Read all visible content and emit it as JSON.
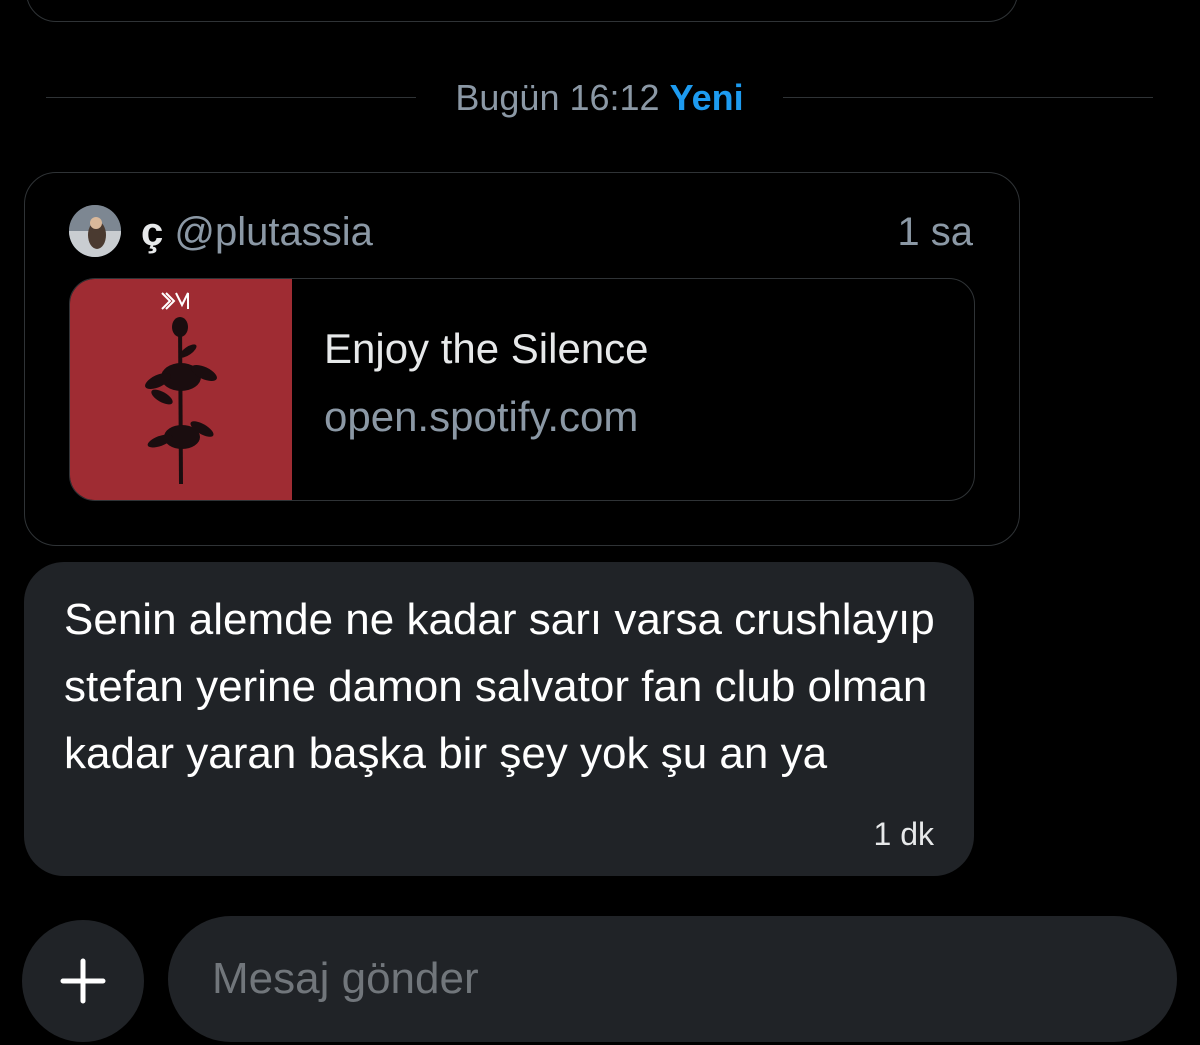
{
  "divider": {
    "time": "Bugün 16:12",
    "new_label": "Yeni"
  },
  "shared_post": {
    "author_name": "ç",
    "author_handle": "@plutassia",
    "time": "1 sa",
    "link": {
      "title": "Enjoy the Silence",
      "domain": "open.spotify.com",
      "thumbnail_color": "#9f2c33"
    }
  },
  "message": {
    "text": "Senin alemde ne kadar sarı varsa crushlayıp stefan yerine damon salvator fan club olman kadar yaran başka bir şey yok şu an ya",
    "time": "1 dk"
  },
  "composer": {
    "placeholder": "Mesaj gönder",
    "add_icon": "plus-icon"
  },
  "colors": {
    "background": "#000000",
    "accent": "#1d9bf0",
    "bubble": "#202327",
    "border": "#2f3336",
    "muted_text": "#8b98a5"
  }
}
